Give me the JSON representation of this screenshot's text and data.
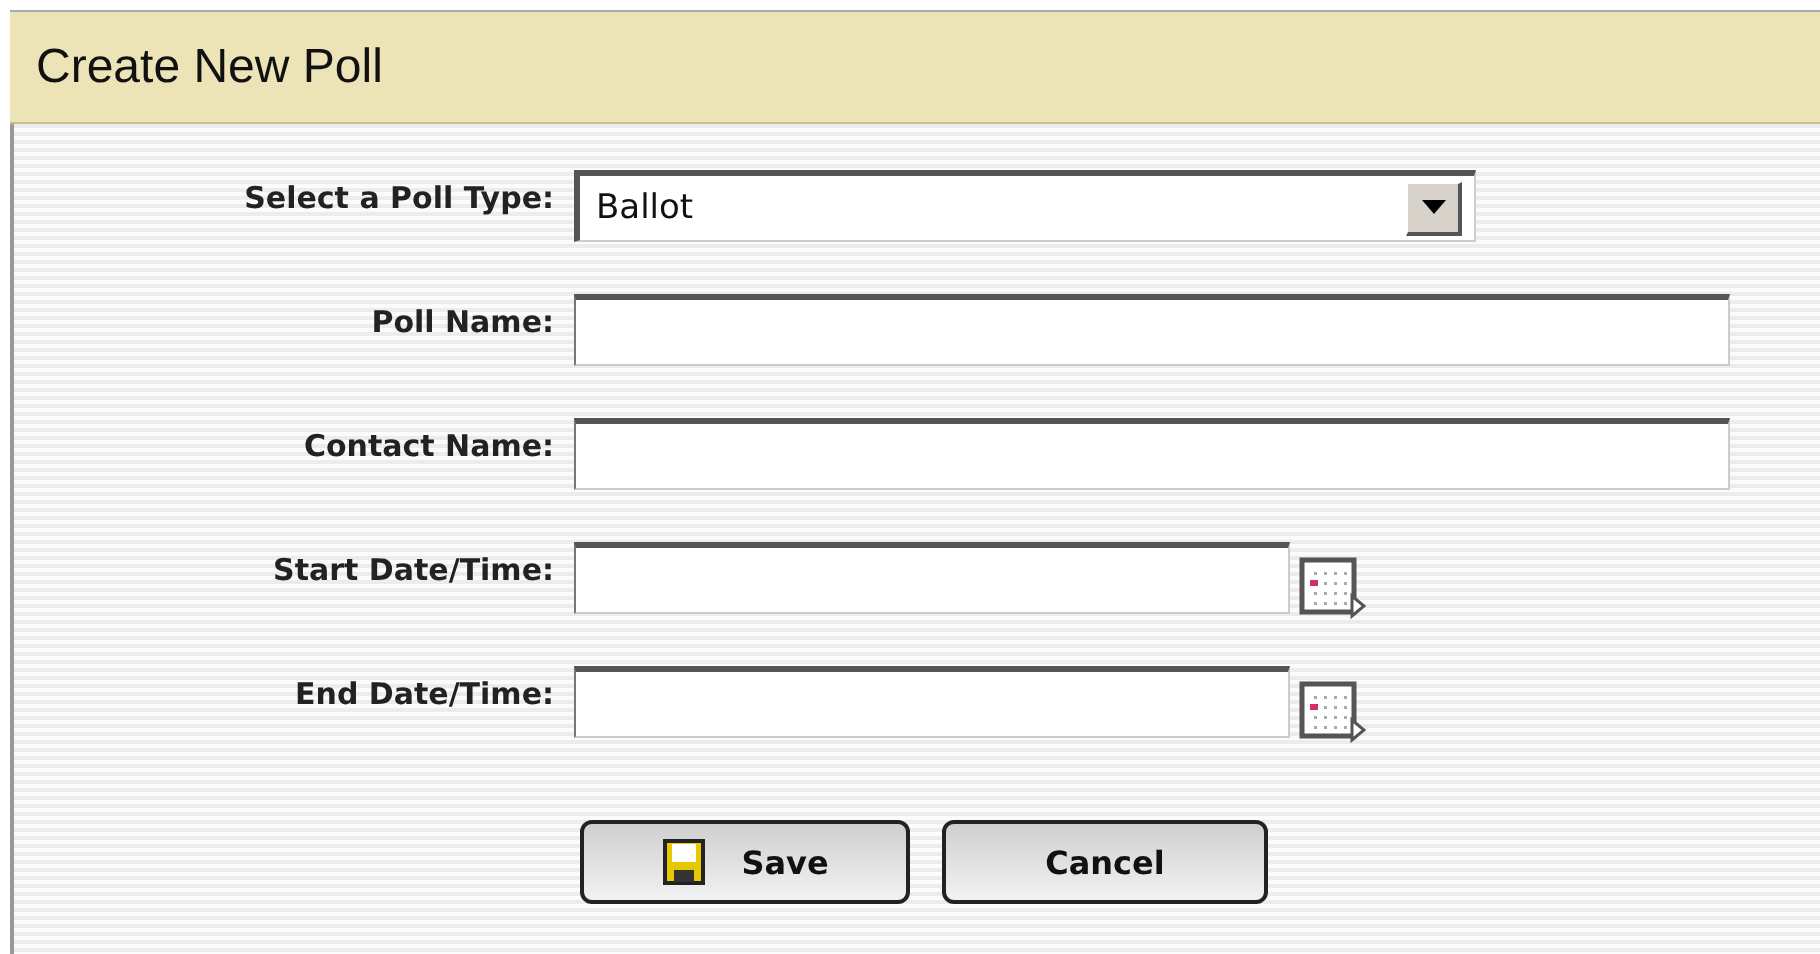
{
  "window": {
    "title": "Create New Poll"
  },
  "fields": [
    {
      "label": "Select a Poll Type:",
      "kind": "select",
      "value": "Ballot"
    },
    {
      "label": "Poll Name:",
      "kind": "text"
    },
    {
      "label": "Contact Name:",
      "kind": "text"
    },
    {
      "label": "Start Date/Time:",
      "kind": "date"
    },
    {
      "label": "End Date/Time:",
      "kind": "date"
    }
  ],
  "buttons": [
    {
      "label": "Save",
      "kind": "save"
    },
    {
      "label": "Cancel",
      "kind": "plain"
    }
  ]
}
